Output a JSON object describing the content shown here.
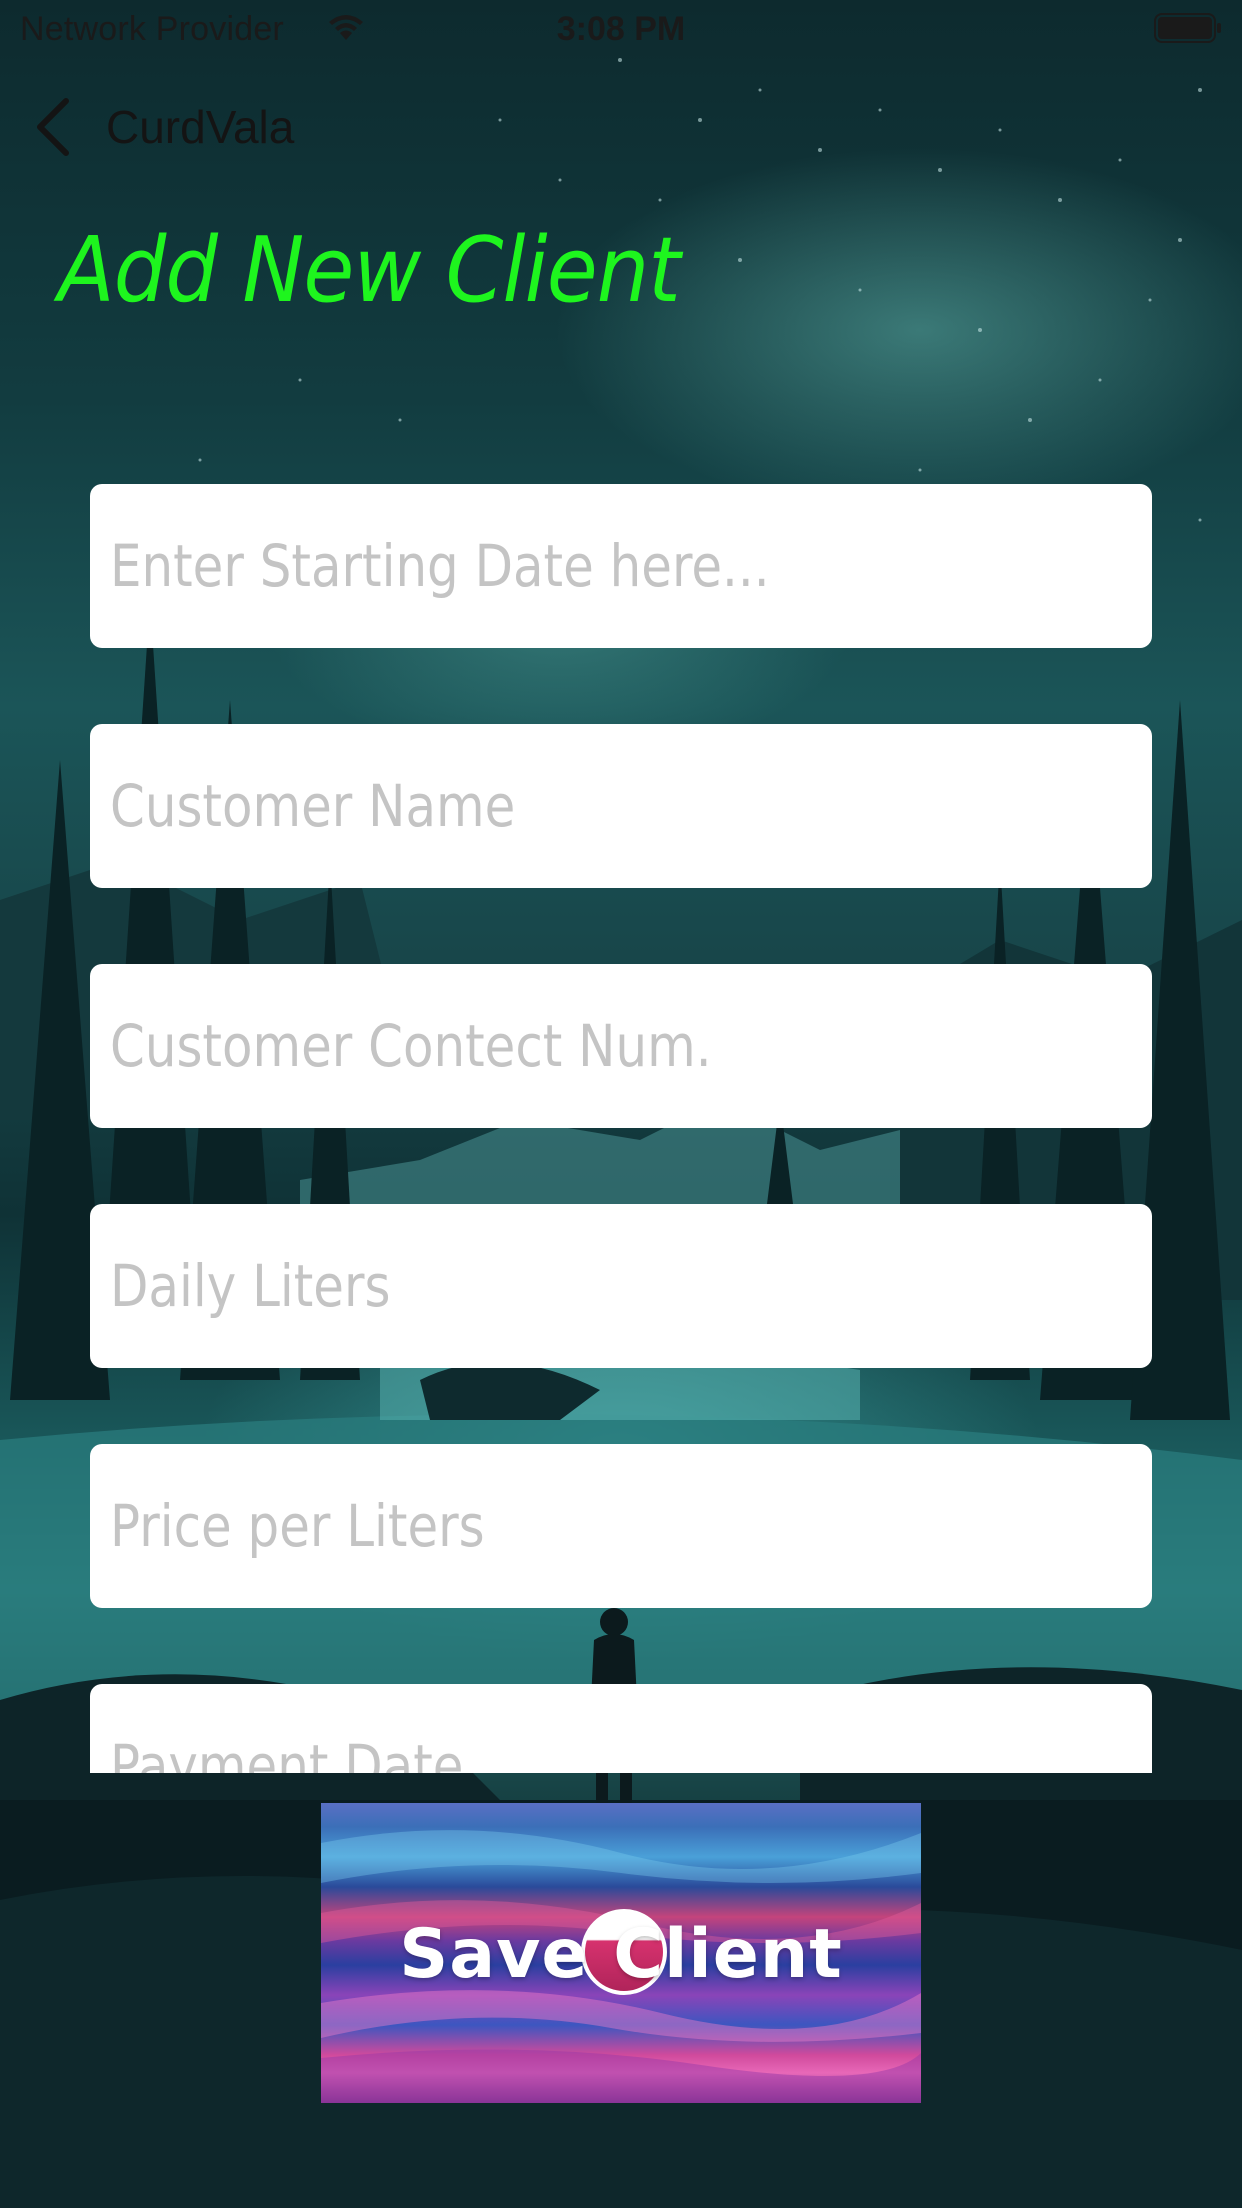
{
  "status_bar": {
    "carrier": "Network Provider",
    "time": "3:08 PM",
    "wifi_icon": "wifi-icon",
    "battery_icon": "battery-icon"
  },
  "nav": {
    "back_label": "CurdVala",
    "back_icon": "chevron-left-icon"
  },
  "page": {
    "title": "Add New Client",
    "title_color": "#1ef51e"
  },
  "form": {
    "fields": [
      {
        "placeholder": "Enter Starting Date here...",
        "value": ""
      },
      {
        "placeholder": "Customer Name",
        "value": ""
      },
      {
        "placeholder": "Customer Contect Num.",
        "value": ""
      },
      {
        "placeholder": "Daily Liters",
        "value": ""
      },
      {
        "placeholder": "Price per Liters",
        "value": ""
      },
      {
        "placeholder": "Payment Date",
        "value": ""
      }
    ]
  },
  "save_button": {
    "label": "Save Client"
  }
}
